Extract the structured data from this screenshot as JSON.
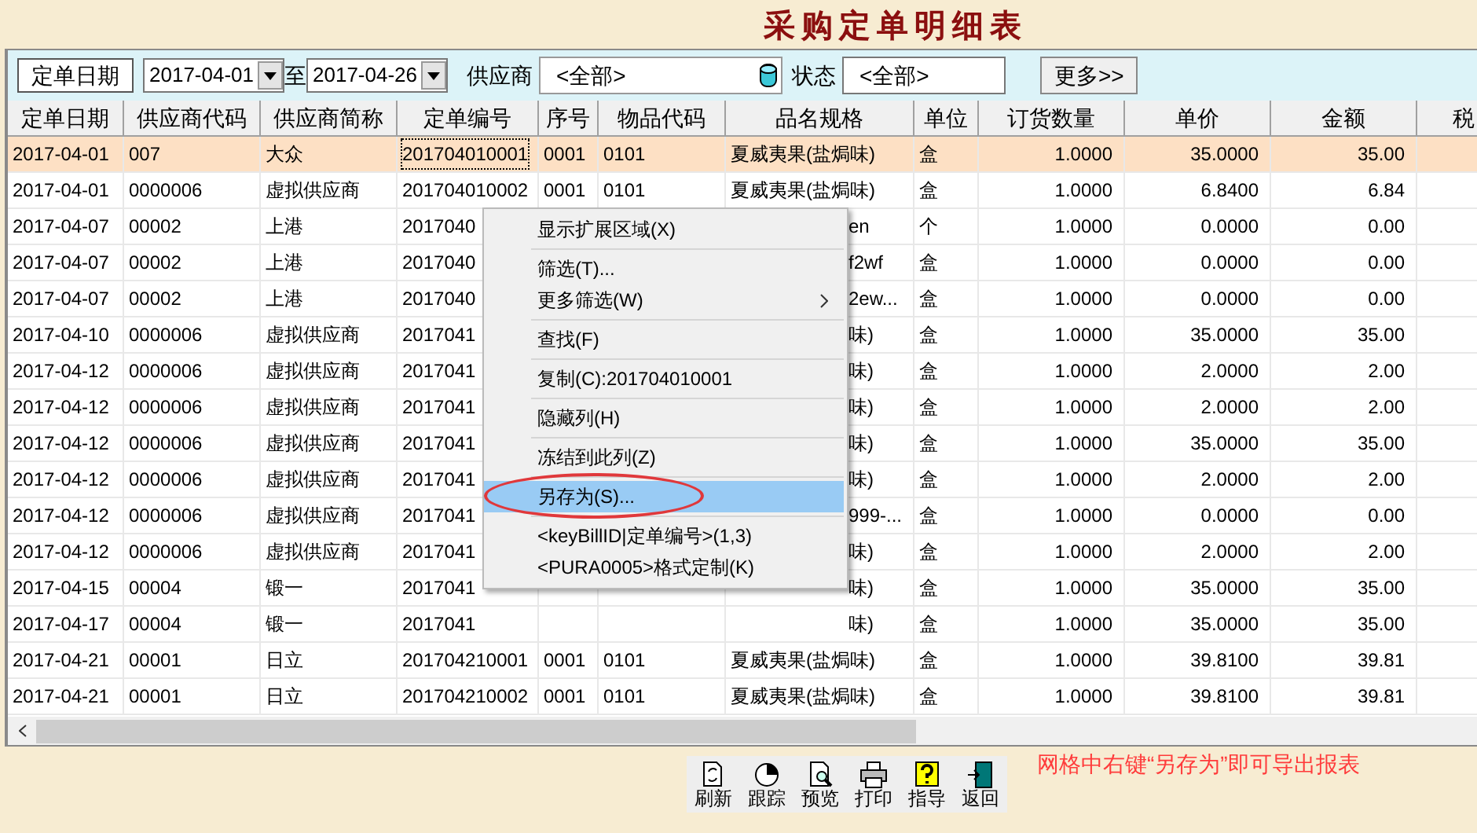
{
  "title": "采购定单明细表",
  "filter": {
    "date_label": "定单日期",
    "date_from": "2017-04-01",
    "to_label": "至",
    "date_to": "2017-04-26",
    "supplier_label": "供应商",
    "supplier_value": "<全部>",
    "status_label": "状态",
    "status_value": "<全部>",
    "more_button": "更多>>"
  },
  "table": {
    "columns": [
      "定单日期",
      "供应商代码",
      "供应商简称",
      "定单编号",
      "序号",
      "物品代码",
      "品名规格",
      "单位",
      "订货数量",
      "单价",
      "金额",
      "税"
    ],
    "rows": [
      {
        "selected": true,
        "cells": [
          "2017-04-01",
          "007",
          "大众",
          "201704010001",
          "0001",
          "0101",
          "夏威夷果(盐焗味)",
          "盒",
          "1.0000",
          "35.0000",
          "35.00"
        ]
      },
      {
        "selected": false,
        "cells": [
          "2017-04-01",
          "0000006",
          "虚拟供应商",
          "201704010002",
          "0001",
          "0101",
          "夏威夷果(盐焗味)",
          "盒",
          "1.0000",
          "6.8400",
          "6.84"
        ]
      },
      {
        "selected": false,
        "cells": [
          "2017-04-07",
          "00002",
          "上港",
          "2017040",
          null,
          null,
          "en",
          "个",
          "1.0000",
          "0.0000",
          "0.00"
        ]
      },
      {
        "selected": false,
        "cells": [
          "2017-04-07",
          "00002",
          "上港",
          "2017040",
          null,
          null,
          "f2wf",
          "盒",
          "1.0000",
          "0.0000",
          "0.00"
        ]
      },
      {
        "selected": false,
        "cells": [
          "2017-04-07",
          "00002",
          "上港",
          "2017040",
          null,
          null,
          "2ew...",
          "盒",
          "1.0000",
          "0.0000",
          "0.00"
        ]
      },
      {
        "selected": false,
        "cells": [
          "2017-04-10",
          "0000006",
          "虚拟供应商",
          "2017041",
          null,
          null,
          "味)",
          "盒",
          "1.0000",
          "35.0000",
          "35.00"
        ]
      },
      {
        "selected": false,
        "cells": [
          "2017-04-12",
          "0000006",
          "虚拟供应商",
          "2017041",
          null,
          null,
          "味)",
          "盒",
          "1.0000",
          "2.0000",
          "2.00"
        ]
      },
      {
        "selected": false,
        "cells": [
          "2017-04-12",
          "0000006",
          "虚拟供应商",
          "2017041",
          null,
          null,
          "味)",
          "盒",
          "1.0000",
          "2.0000",
          "2.00"
        ]
      },
      {
        "selected": false,
        "cells": [
          "2017-04-12",
          "0000006",
          "虚拟供应商",
          "2017041",
          null,
          null,
          "味)",
          "盒",
          "1.0000",
          "35.0000",
          "35.00"
        ]
      },
      {
        "selected": false,
        "cells": [
          "2017-04-12",
          "0000006",
          "虚拟供应商",
          "2017041",
          null,
          null,
          "味)",
          "盒",
          "1.0000",
          "2.0000",
          "2.00"
        ]
      },
      {
        "selected": false,
        "cells": [
          "2017-04-12",
          "0000006",
          "虚拟供应商",
          "2017041",
          null,
          null,
          "999-...",
          "盒",
          "1.0000",
          "0.0000",
          "0.00"
        ]
      },
      {
        "selected": false,
        "cells": [
          "2017-04-12",
          "0000006",
          "虚拟供应商",
          "2017041",
          null,
          null,
          "味)",
          "盒",
          "1.0000",
          "2.0000",
          "2.00"
        ]
      },
      {
        "selected": false,
        "cells": [
          "2017-04-15",
          "00004",
          "锻一",
          "2017041",
          null,
          null,
          "味)",
          "盒",
          "1.0000",
          "35.0000",
          "35.00"
        ]
      },
      {
        "selected": false,
        "cells": [
          "2017-04-17",
          "00004",
          "锻一",
          "2017041",
          null,
          null,
          "味)",
          "盒",
          "1.0000",
          "35.0000",
          "35.00"
        ]
      },
      {
        "selected": false,
        "cells": [
          "2017-04-21",
          "00001",
          "日立",
          "201704210001",
          "0001",
          "0101",
          "夏威夷果(盐焗味)",
          "盒",
          "1.0000",
          "39.8100",
          "39.81"
        ]
      },
      {
        "selected": false,
        "cells": [
          "2017-04-21",
          "00001",
          "日立",
          "201704210002",
          "0001",
          "0101",
          "夏威夷果(盐焗味)",
          "盒",
          "1.0000",
          "39.8100",
          "39.81"
        ]
      }
    ]
  },
  "context_menu": {
    "items": [
      {
        "kind": "item",
        "label": "显示扩展区域(X)",
        "selected": false,
        "submenu": false
      },
      {
        "kind": "separator"
      },
      {
        "kind": "item",
        "label": "筛选(T)...",
        "selected": false,
        "submenu": false
      },
      {
        "kind": "item",
        "label": "更多筛选(W)",
        "selected": false,
        "submenu": true
      },
      {
        "kind": "separator"
      },
      {
        "kind": "item",
        "label": "查找(F)",
        "selected": false,
        "submenu": false
      },
      {
        "kind": "separator"
      },
      {
        "kind": "item",
        "label": "复制(C):201704010001",
        "selected": false,
        "submenu": false
      },
      {
        "kind": "separator"
      },
      {
        "kind": "item",
        "label": "隐藏列(H)",
        "selected": false,
        "submenu": false
      },
      {
        "kind": "separator"
      },
      {
        "kind": "item",
        "label": "冻结到此列(Z)",
        "selected": false,
        "submenu": false
      },
      {
        "kind": "separator"
      },
      {
        "kind": "item",
        "label": "另存为(S)...",
        "selected": true,
        "submenu": false
      },
      {
        "kind": "separator"
      },
      {
        "kind": "item",
        "label": "<keyBillID|定单编号>(1,3)",
        "selected": false,
        "submenu": false
      },
      {
        "kind": "item",
        "label": "<PURA0005>格式定制(K)",
        "selected": false,
        "submenu": false
      }
    ]
  },
  "hint": "网格中右键“另存为”即可导出报表",
  "toolbar": [
    {
      "kind": "refresh",
      "label": "刷新"
    },
    {
      "kind": "track",
      "label": "跟踪"
    },
    {
      "kind": "preview",
      "label": "预览"
    },
    {
      "kind": "print",
      "label": "打印"
    },
    {
      "kind": "help",
      "label": "指导"
    },
    {
      "kind": "exit",
      "label": "返回"
    }
  ]
}
